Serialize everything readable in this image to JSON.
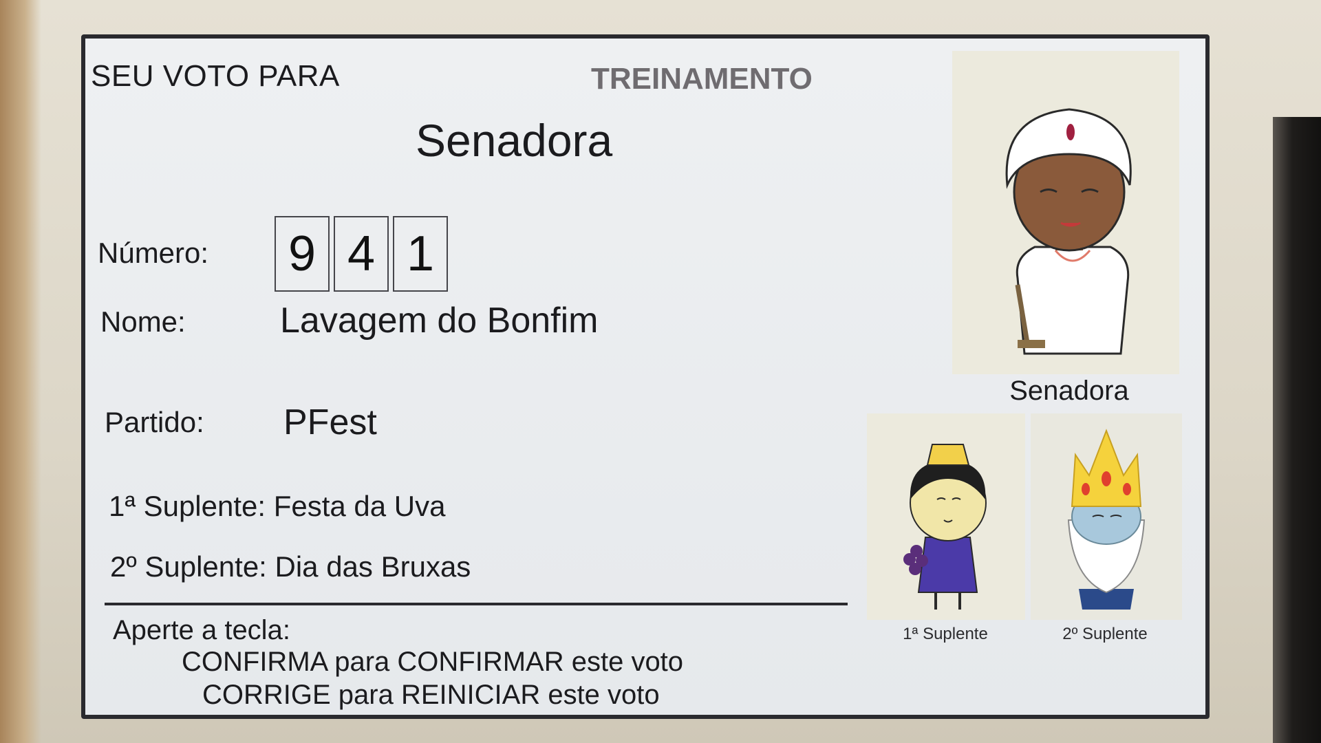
{
  "header": {
    "title": "SEU VOTO PARA",
    "mode": "TREINAMENTO"
  },
  "office": "Senadora",
  "fields": {
    "numero_label": "Número:",
    "digits": [
      "9",
      "4",
      "1"
    ],
    "nome_label": "Nome:",
    "nome_value": "Lavagem do Bonfim",
    "partido_label": "Partido:",
    "partido_value": "PFest"
  },
  "suplentes": {
    "first_line": "1ª Suplente: Festa da Uva",
    "second_line": "2º Suplente: Dia das Bruxas"
  },
  "instructions": {
    "head": "Aperte a tecla:",
    "confirm": "CONFIRMA para CONFIRMAR este voto",
    "correct": "CORRIGE para REINICIAR este voto"
  },
  "photos": {
    "main_caption": "Senadora",
    "s1_caption": "1ª Suplente",
    "s2_caption": "2º Suplente"
  },
  "colors": {
    "screen_bg": "#e9ecef",
    "bezel": "#dcd6c7",
    "text": "#1b1b1e",
    "treinamento": "#6f6c70"
  }
}
